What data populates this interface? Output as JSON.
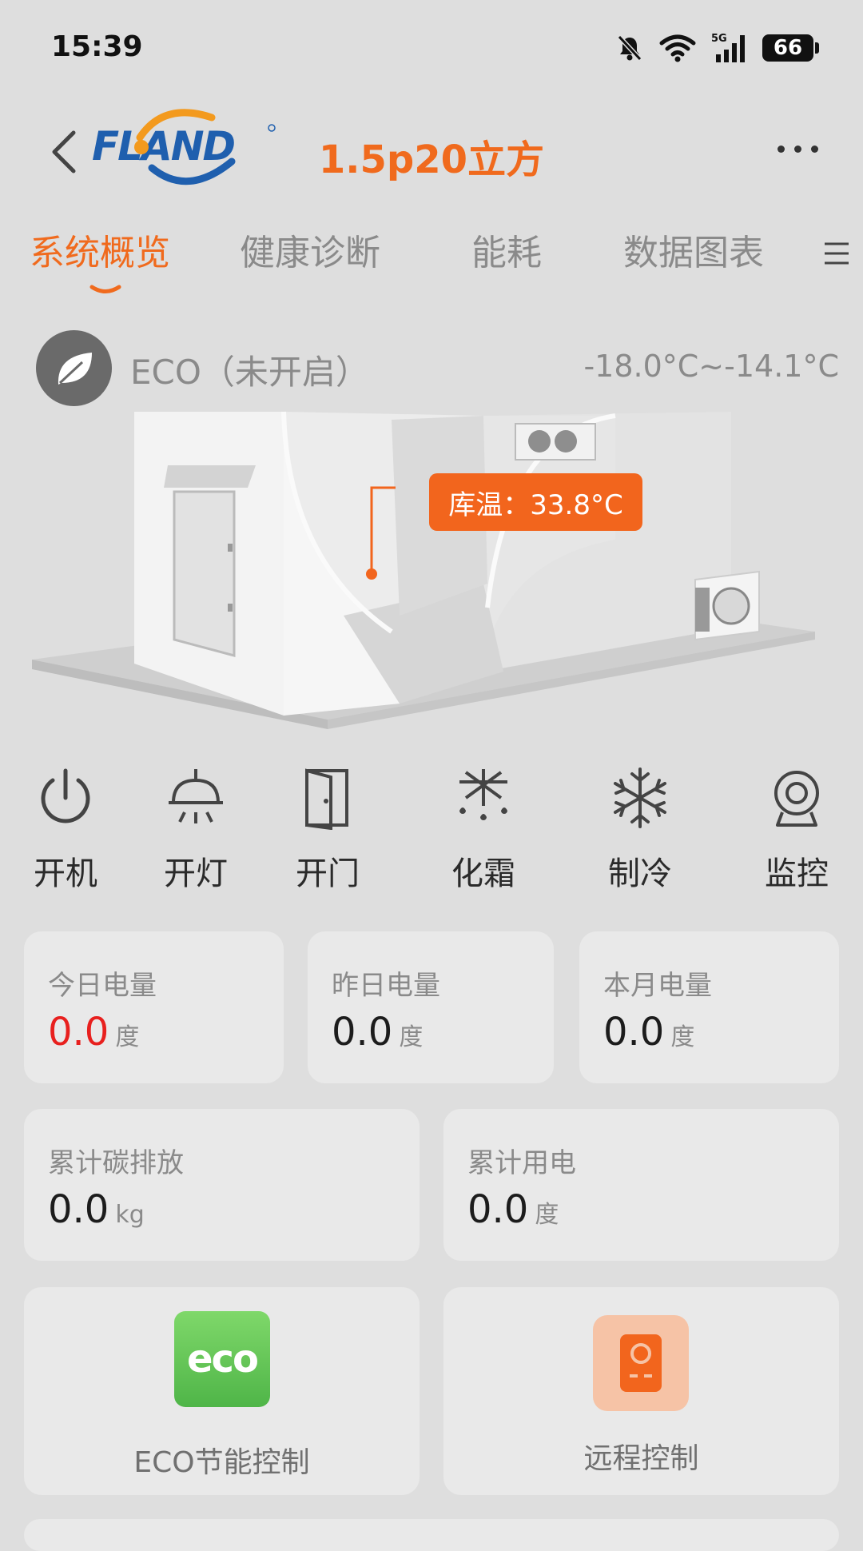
{
  "status_bar": {
    "time": "15:39",
    "battery": "66",
    "network": "5G"
  },
  "header": {
    "title": "1.5p20立方",
    "logo_text": "FLAND"
  },
  "tabs": [
    {
      "label": "系统概览",
      "active": true
    },
    {
      "label": "健康诊断",
      "active": false
    },
    {
      "label": "能耗",
      "active": false
    },
    {
      "label": "数据图表",
      "active": false
    }
  ],
  "eco": {
    "label": "ECO（未开启）",
    "temp_range": "-18.0°C~-14.1°C"
  },
  "room": {
    "temp_label": "库温：33.8°C"
  },
  "controls": [
    {
      "label": "开机",
      "icon": "power-icon"
    },
    {
      "label": "开灯",
      "icon": "light-icon"
    },
    {
      "label": "开门",
      "icon": "door-icon"
    },
    {
      "label": "化霜",
      "icon": "defrost-icon"
    },
    {
      "label": "制冷",
      "icon": "snowflake-icon"
    },
    {
      "label": "监控",
      "icon": "camera-icon"
    }
  ],
  "energy": {
    "today": {
      "label": "今日电量",
      "value": "0.0",
      "unit": "度"
    },
    "yesterday": {
      "label": "昨日电量",
      "value": "0.0",
      "unit": "度"
    },
    "month": {
      "label": "本月电量",
      "value": "0.0",
      "unit": "度"
    },
    "carbon": {
      "label": "累计碳排放",
      "value": "0.0",
      "unit": "kg"
    },
    "total": {
      "label": "累计用电",
      "value": "0.0",
      "unit": "度"
    }
  },
  "features": {
    "eco_control": {
      "label": "ECO节能控制",
      "icon_text": "eco"
    },
    "remote_control": {
      "label": "远程控制"
    }
  },
  "colors": {
    "accent": "#f06a1d",
    "alert_red": "#e8201e",
    "eco_green": "#5fc35a"
  }
}
